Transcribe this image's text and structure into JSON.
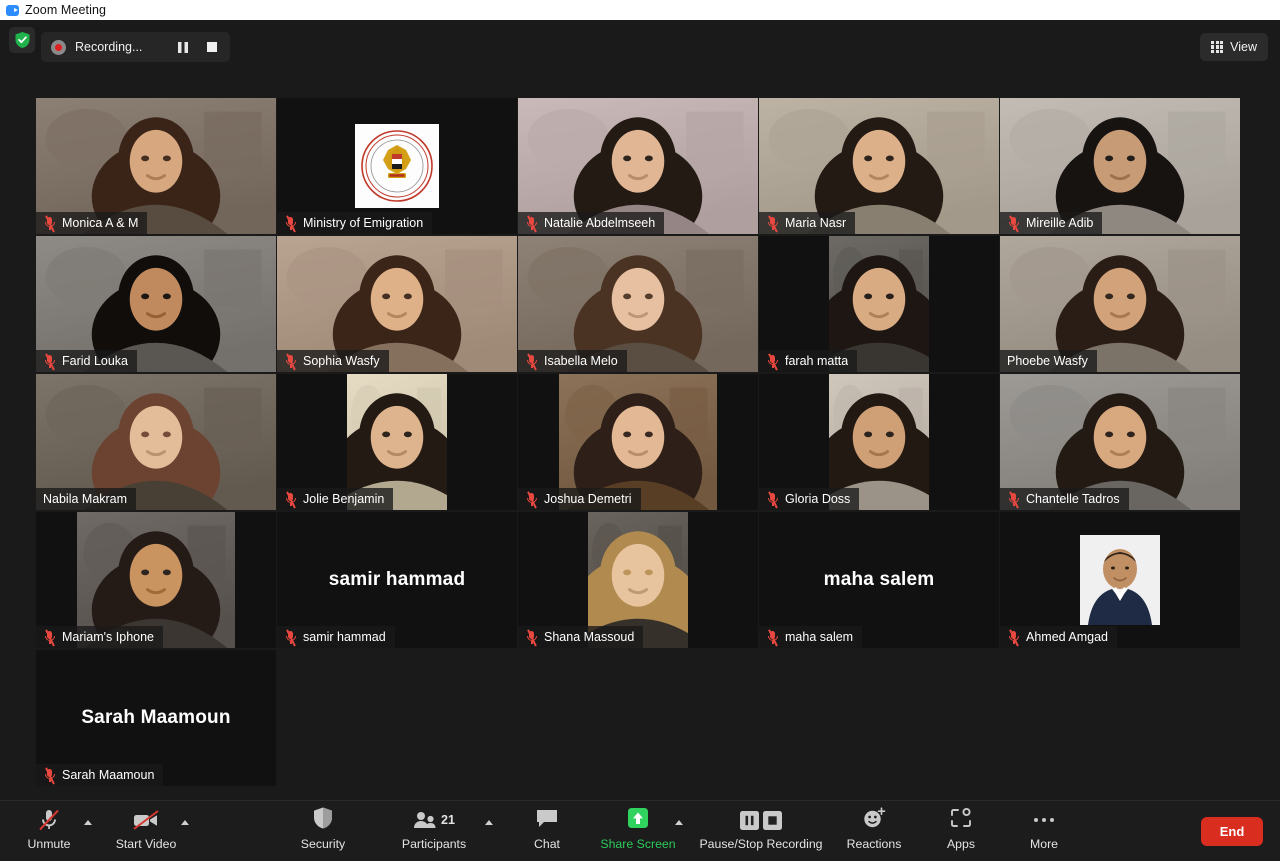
{
  "window": {
    "title": "Zoom Meeting",
    "logo_icon": "zoom-logo-icon"
  },
  "topbar": {
    "shield_icon": "shield-check-icon",
    "recording": {
      "record_icon": "record-dot-icon",
      "label": "Recording...",
      "pause_icon": "pause-icon",
      "stop_icon": "stop-icon"
    },
    "view": {
      "icon": "grid-view-icon",
      "label": "View"
    }
  },
  "colors": {
    "active_speaker_border": "#8FE000",
    "muted_mic": "#e8483f",
    "share_screen_green": "#2eca5c",
    "end_button_red": "#d92d20",
    "tile_background": "#111111",
    "stage_background": "#1a1a1a"
  },
  "gallery": {
    "participants": [
      {
        "name": "Monica A & M",
        "muted": true,
        "active_speaker": false,
        "video": true,
        "layout": "full",
        "skin": "#d7a77f",
        "hair": "#3a2418",
        "bg": "#8c7f73"
      },
      {
        "name": "Ministry of Emigration",
        "muted": true,
        "active_speaker": false,
        "video": false,
        "layout": "logo",
        "logo": "egypt-emblem-icon"
      },
      {
        "name": "Natalie Abdelmseeh",
        "muted": true,
        "active_speaker": false,
        "video": true,
        "layout": "full",
        "skin": "#e0b694",
        "hair": "#241a14",
        "bg": "#c9b9b9"
      },
      {
        "name": "Maria Nasr",
        "muted": true,
        "active_speaker": false,
        "video": true,
        "layout": "full",
        "skin": "#dcb088",
        "hair": "#241a14",
        "bg": "#bdb3a4"
      },
      {
        "name": "Mireille Adib",
        "muted": true,
        "active_speaker": false,
        "video": true,
        "layout": "full",
        "skin": "#c79b76",
        "hair": "#171311",
        "bg": "#c2bcb4"
      },
      {
        "name": "Farid Louka",
        "muted": true,
        "active_speaker": false,
        "video": true,
        "layout": "full",
        "skin": "#c08a5e",
        "hair": "#110d0a",
        "bg": "#8e8a85"
      },
      {
        "name": "Sophia Wasfy",
        "muted": true,
        "active_speaker": false,
        "video": true,
        "layout": "full",
        "skin": "#dfb189",
        "hair": "#3b2519",
        "bg": "#b9a391"
      },
      {
        "name": "Isabella Melo",
        "muted": true,
        "active_speaker": false,
        "video": true,
        "layout": "full",
        "skin": "#e6c0a0",
        "hair": "#4a3322",
        "bg": "#8e8175"
      },
      {
        "name": "farah matta",
        "muted": true,
        "active_speaker": false,
        "video": true,
        "layout": "portrait",
        "skin": "#d9ab82",
        "hair": "#1d1613",
        "bg": "#6d6a65"
      },
      {
        "name": "Phoebe Wasfy",
        "muted": false,
        "active_speaker": true,
        "video": true,
        "layout": "full",
        "skin": "#d2a27a",
        "hair": "#2a1d16",
        "bg": "#b0a79c"
      },
      {
        "name": "Nabila Makram",
        "muted": false,
        "active_speaker": false,
        "video": true,
        "layout": "full",
        "skin": "#e3bd9a",
        "hair": "#6b4330",
        "bg": "#7d7469"
      },
      {
        "name": "Jolie Benjamin",
        "muted": true,
        "active_speaker": false,
        "video": true,
        "layout": "portrait",
        "skin": "#ddb48d",
        "hair": "#231a13",
        "bg": "#e6dcc4"
      },
      {
        "name": "Joshua Demetri",
        "muted": true,
        "active_speaker": false,
        "video": true,
        "layout": "wide",
        "skin": "#e2b994",
        "hair": "#2e2019",
        "bg": "#8c7258"
      },
      {
        "name": "Gloria Doss",
        "muted": true,
        "active_speaker": false,
        "video": true,
        "layout": "portrait",
        "skin": "#cf9f76",
        "hair": "#211912",
        "bg": "#cfc6bc"
      },
      {
        "name": "Chantelle Tadros",
        "muted": true,
        "active_speaker": false,
        "video": true,
        "layout": "full",
        "skin": "#d8a87f",
        "hair": "#241a14",
        "bg": "#9d9a96"
      },
      {
        "name": "Mariam's Iphone",
        "muted": true,
        "active_speaker": false,
        "video": true,
        "layout": "wide",
        "skin": "#c9945f",
        "hair": "#241a16",
        "bg": "#6f6a66"
      },
      {
        "name": "samir hammad",
        "muted": true,
        "active_speaker": false,
        "video": false,
        "layout": "nameonly"
      },
      {
        "name": "Shana Massoud",
        "muted": true,
        "active_speaker": false,
        "video": true,
        "layout": "portrait",
        "skin": "#e8c49e",
        "hair": "#b08a4e",
        "bg": "#6a645e"
      },
      {
        "name": "maha  salem",
        "muted": true,
        "active_speaker": false,
        "video": false,
        "layout": "nameonly"
      },
      {
        "name": "Ahmed Amgad",
        "muted": true,
        "active_speaker": false,
        "video": false,
        "layout": "avatar",
        "skin": "#c08f63",
        "hair": "#2b2018",
        "bg": "#eeeeee"
      },
      {
        "name": "Sarah Maamoun",
        "muted": true,
        "active_speaker": false,
        "video": false,
        "layout": "nameonly"
      }
    ]
  },
  "toolbar": {
    "items": [
      {
        "label": "Unmute",
        "icon": "microphone-muted-icon",
        "caret": true,
        "highlight": false
      },
      {
        "label": "Start Video",
        "icon": "video-camera-off-icon",
        "caret": true,
        "highlight": false
      },
      {
        "label": "Security",
        "icon": "shield-icon",
        "caret": false,
        "highlight": false
      },
      {
        "label": "Participants",
        "icon": "participants-icon",
        "caret": true,
        "highlight": false,
        "badge": "21"
      },
      {
        "label": "Chat",
        "icon": "chat-bubble-icon",
        "caret": false,
        "highlight": false
      },
      {
        "label": "Share Screen",
        "icon": "share-screen-up-arrow-icon",
        "caret": true,
        "highlight": true
      },
      {
        "label": "Pause/Stop Recording",
        "icon": "pause-stop-recording-icon",
        "caret": false,
        "highlight": false
      },
      {
        "label": "Reactions",
        "icon": "smiley-plus-icon",
        "caret": false,
        "highlight": false
      },
      {
        "label": "Apps",
        "icon": "apps-bracket-icon",
        "caret": false,
        "highlight": false
      },
      {
        "label": "More",
        "icon": "more-dots-icon",
        "caret": false,
        "highlight": false
      }
    ],
    "end_button": {
      "label": "End"
    }
  }
}
